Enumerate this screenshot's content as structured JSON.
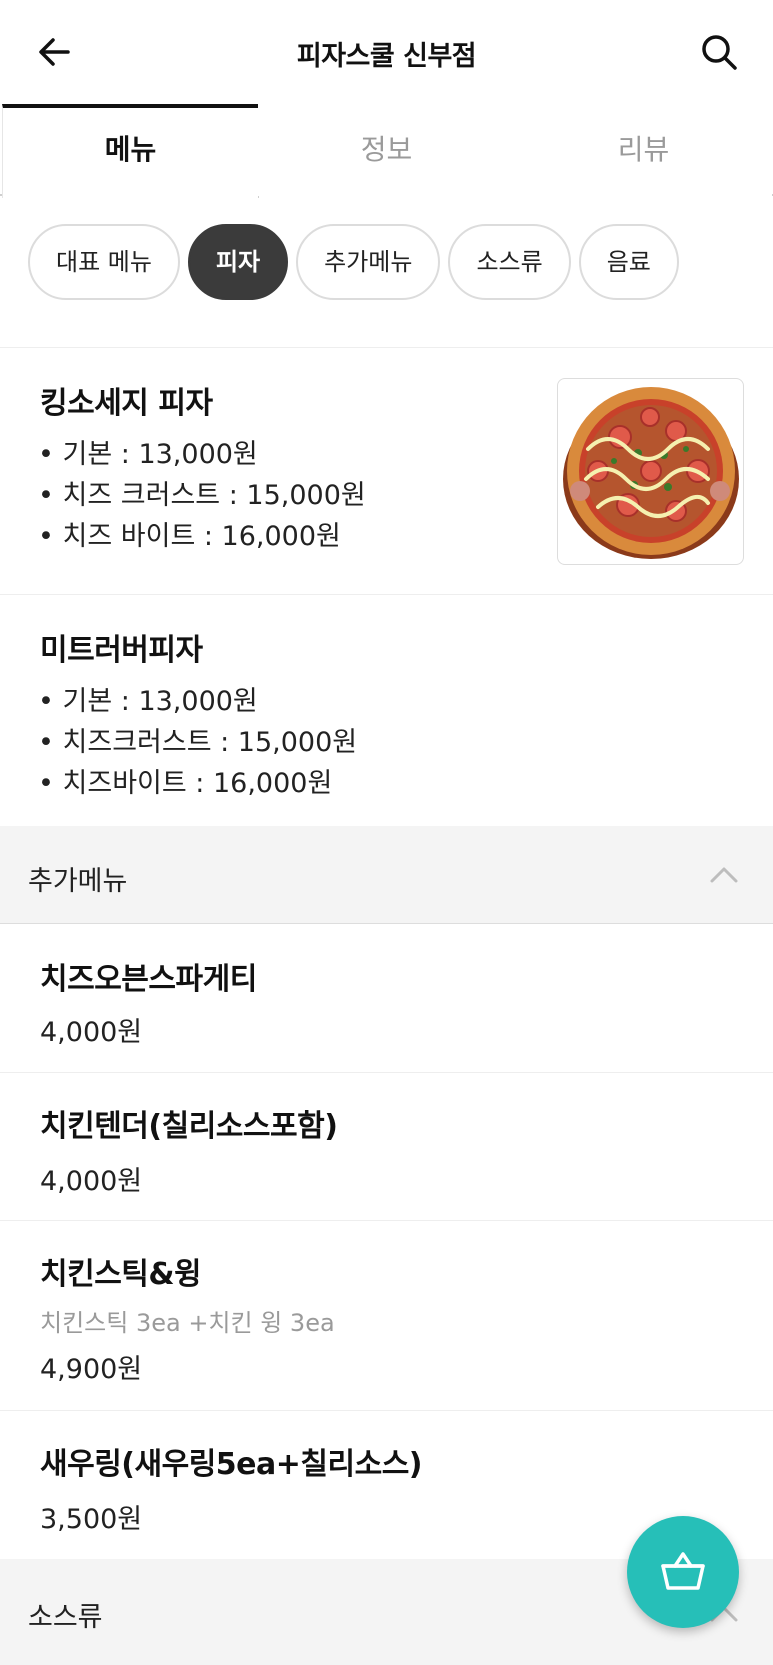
{
  "header": {
    "title": "피자스쿨 신부점",
    "back_icon": "arrow-left-icon",
    "search_icon": "search-icon"
  },
  "tabs": [
    {
      "label": "메뉴",
      "active": true
    },
    {
      "label": "정보",
      "active": false
    },
    {
      "label": "리뷰",
      "active": false
    }
  ],
  "categories": [
    {
      "label": "대표 메뉴",
      "active": false
    },
    {
      "label": "피자",
      "active": true
    },
    {
      "label": "추가메뉴",
      "active": false
    },
    {
      "label": "소스류",
      "active": false
    },
    {
      "label": "음료",
      "active": false
    }
  ],
  "pizza_items": [
    {
      "name": "킹소세지 피자",
      "options": [
        "• 기본 : 13,000원",
        "• 치즈 크러스트 : 15,000원",
        "• 치즈 바이트 : 16,000원"
      ],
      "has_image": true
    },
    {
      "name": "미트러버피자",
      "options": [
        "• 기본 : 13,000원",
        "• 치즈크러스트 : 15,000원",
        "• 치즈바이트 : 16,000원"
      ],
      "has_image": false
    }
  ],
  "sections": {
    "extra": {
      "label": "추가메뉴",
      "chevron_icon": "chevron-up-icon"
    },
    "sauce": {
      "label": "소스류",
      "chevron_icon": "chevron-up-icon"
    }
  },
  "extra_items": [
    {
      "name": "치즈오븐스파게티",
      "price": "4,000원"
    },
    {
      "name": "치킨텐더(칠리소스포함)",
      "price": "4,000원"
    },
    {
      "name": "치킨스틱&윙",
      "desc": "치킨스틱 3ea +치킨 윙 3ea",
      "price": "4,900원"
    },
    {
      "name": "새우링(새우링5ea+칠리소스)",
      "price": "3,500원"
    }
  ],
  "cart_button": {
    "icon": "basket-icon",
    "color": "#26bfb8"
  }
}
